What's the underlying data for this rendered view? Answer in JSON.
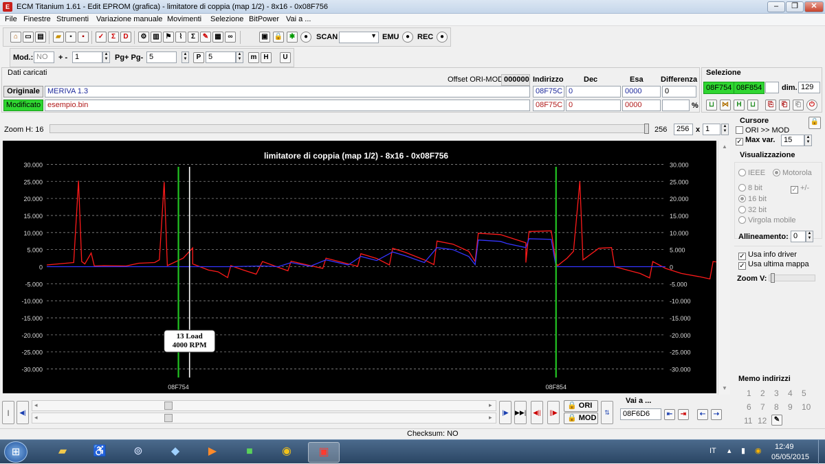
{
  "window": {
    "title": "ECM Titanium 1.61 - Edit EPROM (grafica) - limitatore di coppia (map 1/2) - 8x16 - 0x08F756"
  },
  "menu": [
    "File",
    "Finestre",
    "Strumenti",
    "Variazione manuale",
    "Movimenti",
    "Selezione",
    "BitPower",
    "Vai a ..."
  ],
  "toolbar": {
    "scan_label": "SCAN",
    "emu_label": "EMU",
    "rec_label": "REC",
    "mod_label": "Mod.:",
    "mod_value": "NO",
    "plusminus_label": "+ -",
    "plusminus_value": "1",
    "pg_label": "Pg+ Pg-",
    "pg_value": "5",
    "p_value": "5"
  },
  "loaded": {
    "title": "Dati caricati",
    "offset_label": "Offset ORI-MOD",
    "offset_value": "000000",
    "col_indirizzo": "Indirizzo",
    "col_dec": "Dec",
    "col_esa": "Esa",
    "col_diff": "Differenza",
    "orig_label": "Originale",
    "orig_file": "MERIVA 1.3",
    "orig_addr": "08F75C",
    "orig_dec": "0",
    "orig_esa": "0000",
    "orig_diff": "0",
    "mod_label": "Modificato",
    "mod_file": "esempio.bin",
    "mod_addr": "08F75C",
    "mod_dec": "0",
    "mod_esa": "0000",
    "mod_diff": "",
    "pct": "%"
  },
  "selection": {
    "title": "Selezione",
    "start": "08F754",
    "end": "08F854",
    "dim_label": "dim.",
    "dim_value": "129"
  },
  "zoom": {
    "label": "Zoom H: 16",
    "val1": "256",
    "val2": "256",
    "x": "x",
    "mult": "1"
  },
  "cursor_panel": {
    "title": "Cursore",
    "ori_mod": "ORI >> MOD",
    "maxvar_label": "Max var.",
    "maxvar_value": "15"
  },
  "view_panel": {
    "title": "Visualizzazione",
    "ieee": "IEEE",
    "motorola": "Motorola",
    "b8": "8 bit",
    "plusminus": "+/-",
    "b16": "16 bit",
    "b32": "32 bit",
    "float": "Virgola mobile",
    "align_label": "Allineamento:",
    "align_value": "0",
    "driver": "Usa info driver",
    "lastmap": "Usa ultima mappa",
    "zoomv": "Zoom V:"
  },
  "memo": {
    "title": "Memo indirizzi",
    "numbers": [
      "1",
      "2",
      "3",
      "4",
      "5",
      "6",
      "7",
      "8",
      "9",
      "10",
      "11",
      "12"
    ]
  },
  "nav": {
    "ori_label": "ORI",
    "mod_label": "MOD",
    "goto_label": "Vai a ...",
    "goto_value": "08F6D6"
  },
  "status": {
    "checksum": "Checksum: NO"
  },
  "taskbar": {
    "lang": "IT",
    "time": "12:49",
    "date": "05/05/2015"
  },
  "colors": {
    "ori_line": "#ff1a1a",
    "mod_line": "#3535ff",
    "marker": "#22c422",
    "cursor": "#ffffff",
    "plot_bg": "#000000",
    "grid": "#8a8a8a"
  },
  "chart_data": {
    "type": "line",
    "title": "limitatore di coppia (map 1/2) - 8x16 - 0x08F756",
    "ylim": [
      -32500,
      32500
    ],
    "yticks": [
      "30.000",
      "25.000",
      "20.000",
      "15.000",
      "10.000",
      "5.000",
      "0",
      "-5.000",
      "-10.000",
      "-15.000",
      "-20.000",
      "-25.000",
      "-30.000"
    ],
    "ytick_values": [
      30000,
      25000,
      20000,
      15000,
      10000,
      5000,
      0,
      -5000,
      -10000,
      -15000,
      -20000,
      -25000,
      -30000
    ],
    "xlim": [
      0,
      390
    ],
    "markers": [
      {
        "x": 83,
        "label": "08F754"
      },
      {
        "x": 321,
        "label": "08F854"
      }
    ],
    "cursor_x": 90,
    "tooltip": [
      "13 Load",
      "4000 RPM"
    ],
    "series": [
      {
        "color": "#ff1a1a",
        "points": [
          [
            0,
            500
          ],
          [
            12,
            1000
          ],
          [
            17,
            1200
          ],
          [
            20,
            25200
          ],
          [
            22,
            1500
          ],
          [
            24,
            800
          ],
          [
            28,
            4000
          ],
          [
            30,
            200
          ],
          [
            36,
            300
          ],
          [
            50,
            200
          ],
          [
            58,
            1000
          ],
          [
            68,
            1200
          ],
          [
            71,
            2000
          ],
          [
            74,
            24800
          ],
          [
            76,
            300
          ],
          [
            86,
            2500
          ],
          [
            92,
            5500
          ],
          [
            92,
            800
          ],
          [
            102,
            -1000
          ],
          [
            108,
            -1500
          ],
          [
            114,
            -3200
          ],
          [
            116,
            300
          ],
          [
            124,
            -1000
          ],
          [
            132,
            -2200
          ],
          [
            136,
            1500
          ],
          [
            146,
            -200
          ],
          [
            152,
            -1200
          ],
          [
            154,
            1600
          ],
          [
            166,
            300
          ],
          [
            174,
            -500
          ],
          [
            176,
            2500
          ],
          [
            190,
            800
          ],
          [
            196,
            100
          ],
          [
            198,
            3800
          ],
          [
            208,
            2400
          ],
          [
            216,
            500
          ],
          [
            218,
            5400
          ],
          [
            226,
            4200
          ],
          [
            238,
            2000
          ],
          [
            244,
            600
          ],
          [
            246,
            7500
          ],
          [
            256,
            6600
          ],
          [
            266,
            4500
          ],
          [
            270,
            1500
          ],
          [
            272,
            9800
          ],
          [
            286,
            9400
          ],
          [
            290,
            8800
          ],
          [
            302,
            7000
          ],
          [
            302,
            1200
          ],
          [
            304,
            10300
          ],
          [
            318,
            10500
          ],
          [
            321,
            1000
          ],
          [
            322,
            300
          ],
          [
            328,
            2500
          ],
          [
            332,
            4500
          ],
          [
            336,
            25000
          ],
          [
            338,
            2000
          ],
          [
            348,
            5400
          ],
          [
            356,
            5600
          ],
          [
            358,
            0
          ],
          [
            366,
            -1000
          ],
          [
            374,
            -2000
          ],
          [
            380,
            -3300
          ],
          [
            382,
            1500
          ],
          [
            390,
            -500
          ],
          [
            400,
            -2000
          ],
          [
            412,
            -3000
          ],
          [
            418,
            -3600
          ],
          [
            420,
            1500
          ],
          [
            428,
            1000
          ]
        ]
      },
      {
        "color": "#3535ff",
        "points": [
          [
            0,
            0
          ],
          [
            86,
            0
          ],
          [
            92,
            0
          ],
          [
            102,
            0
          ],
          [
            114,
            0
          ],
          [
            116,
            0
          ],
          [
            136,
            200
          ],
          [
            146,
            0
          ],
          [
            154,
            1200
          ],
          [
            166,
            100
          ],
          [
            176,
            2000
          ],
          [
            190,
            500
          ],
          [
            198,
            3000
          ],
          [
            208,
            1800
          ],
          [
            218,
            4300
          ],
          [
            226,
            3200
          ],
          [
            238,
            1200
          ],
          [
            246,
            5600
          ],
          [
            256,
            5000
          ],
          [
            266,
            3000
          ],
          [
            270,
            600
          ],
          [
            272,
            7800
          ],
          [
            286,
            7400
          ],
          [
            290,
            6800
          ],
          [
            302,
            5600
          ],
          [
            304,
            8200
          ],
          [
            318,
            8000
          ],
          [
            321,
            0
          ],
          [
            336,
            0
          ],
          [
            390,
            0
          ]
        ]
      }
    ]
  }
}
